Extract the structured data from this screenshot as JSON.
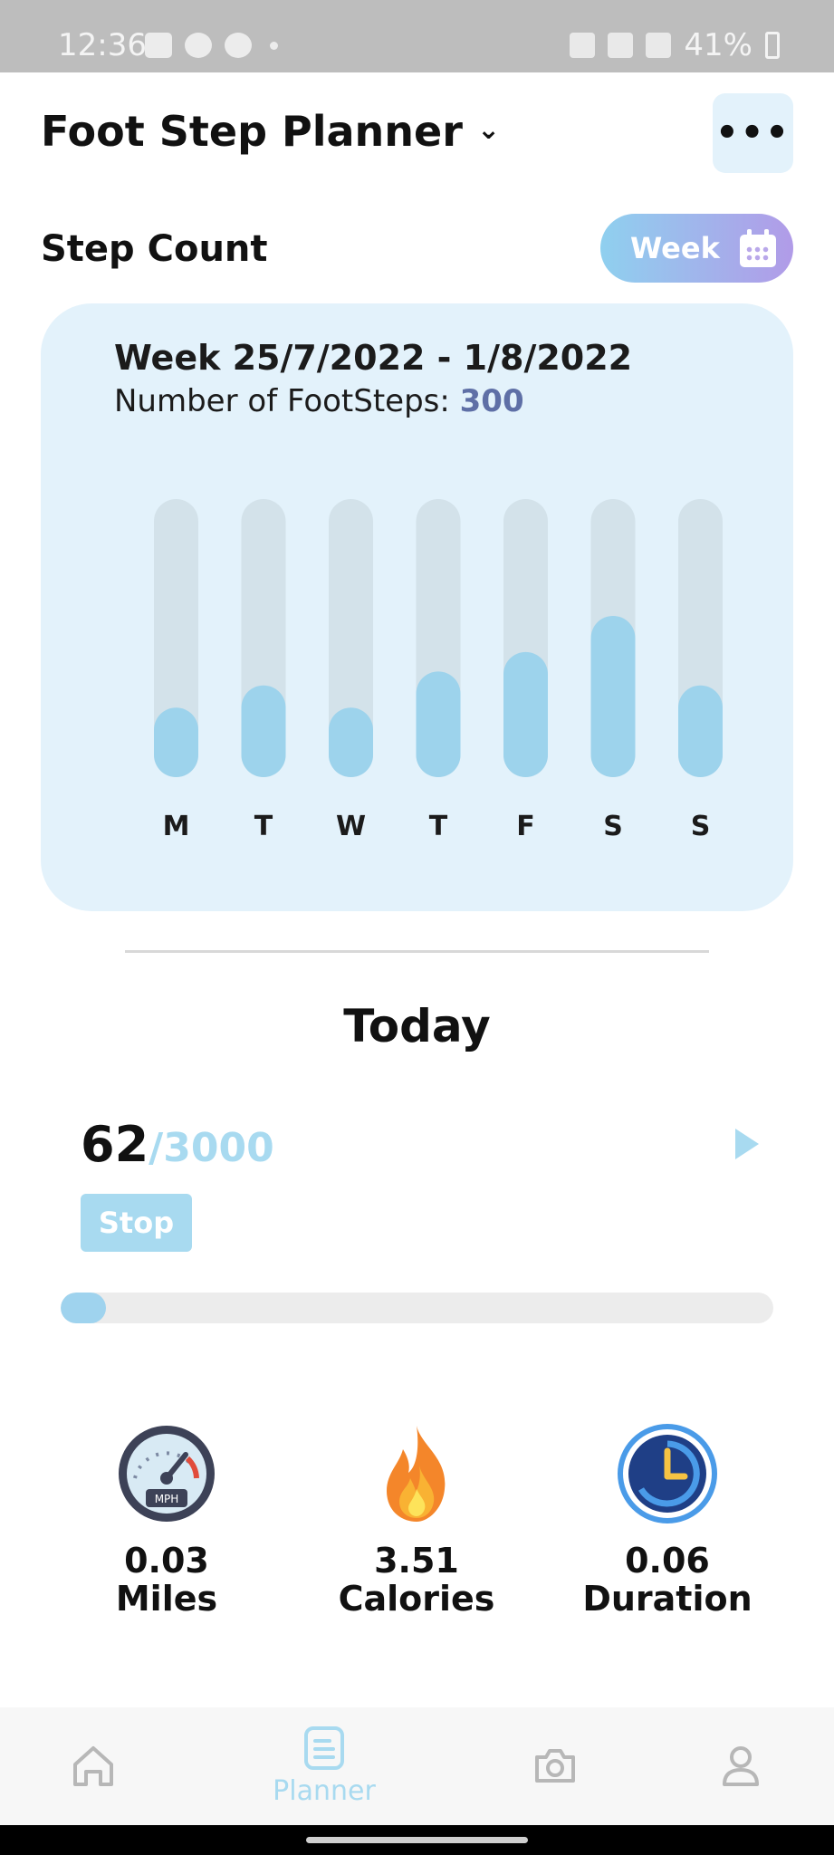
{
  "status_bar": {
    "time": "12:36",
    "battery": "41%"
  },
  "header": {
    "title": "Foot Step Planner",
    "more_label": "•••"
  },
  "step_count": {
    "section_title": "Step Count",
    "range_button": "Week",
    "week_label": "Week 25/7/2022 - 1/8/2022",
    "footsteps_label": "Number of FootSteps: ",
    "footsteps_value": "300"
  },
  "chart_data": {
    "type": "bar",
    "categories": [
      "M",
      "T",
      "W",
      "T",
      "F",
      "S",
      "S"
    ],
    "values": [
      0.25,
      0.33,
      0.25,
      0.38,
      0.45,
      0.58,
      0.33
    ],
    "ylim": [
      0,
      1
    ],
    "colors": {
      "track": "#d3e2ea",
      "bar": "#9dd3ec"
    }
  },
  "today": {
    "title": "Today",
    "steps_current": "62",
    "steps_goal": "/3000",
    "stop_label": "Stop",
    "progress_fraction": 0.0207
  },
  "stats": [
    {
      "value": "0.03",
      "label": "Miles",
      "icon": "speedometer-icon"
    },
    {
      "value": "3.51",
      "label": "Calories",
      "icon": "flame-icon"
    },
    {
      "value": "0.06",
      "label": "Duration",
      "icon": "clock-icon"
    }
  ],
  "nav": {
    "items": [
      {
        "icon": "home-icon",
        "label": ""
      },
      {
        "icon": "planner-icon",
        "label": "Planner"
      },
      {
        "icon": "camera-icon",
        "label": ""
      },
      {
        "icon": "profile-icon",
        "label": ""
      }
    ],
    "accent": "#a8daf0"
  }
}
